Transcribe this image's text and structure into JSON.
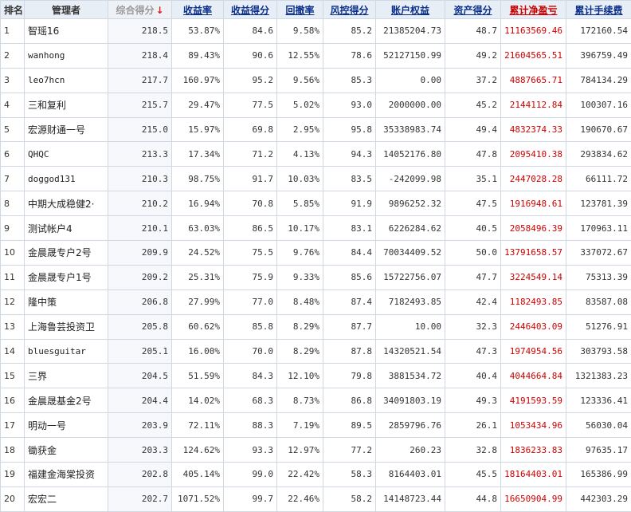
{
  "headers": {
    "rank": "排名",
    "manager": "管理者",
    "composite": "综合得分",
    "composite_arrow": "↓",
    "return_rate": "收益率",
    "return_score": "收益得分",
    "drawdown": "回撤率",
    "risk_score": "风控得分",
    "equity": "账户权益",
    "asset_score": "资产得分",
    "cum_pnl": "累计净盈亏",
    "cum_fee": "累计手续费"
  },
  "colors": {
    "header_link": "#0a2f8a",
    "pnl_red": "#d00000",
    "sort_arrow": "#e02020",
    "header_bg": "#e8eef5",
    "border": "#cfd8e3"
  },
  "rows": [
    {
      "rank": "1",
      "manager": "智瑶16",
      "composite": "218.5",
      "return_rate": "53.87%",
      "return_score": "84.6",
      "drawdown": "9.58%",
      "risk_score": "85.2",
      "equity": "21385204.73",
      "asset_score": "48.7",
      "cum_pnl": "11163569.46",
      "cum_fee": "172160.54"
    },
    {
      "rank": "2",
      "manager": "wanhong",
      "composite": "218.4",
      "return_rate": "89.43%",
      "return_score": "90.6",
      "drawdown": "12.55%",
      "risk_score": "78.6",
      "equity": "52127150.99",
      "asset_score": "49.2",
      "cum_pnl": "21604565.51",
      "cum_fee": "396759.49"
    },
    {
      "rank": "3",
      "manager": "leo7hcn",
      "composite": "217.7",
      "return_rate": "160.97%",
      "return_score": "95.2",
      "drawdown": "9.56%",
      "risk_score": "85.3",
      "equity": "0.00",
      "asset_score": "37.2",
      "cum_pnl": "4887665.71",
      "cum_fee": "784134.29"
    },
    {
      "rank": "4",
      "manager": "三和复利",
      "composite": "215.7",
      "return_rate": "29.47%",
      "return_score": "77.5",
      "drawdown": "5.02%",
      "risk_score": "93.0",
      "equity": "2000000.00",
      "asset_score": "45.2",
      "cum_pnl": "2144112.84",
      "cum_fee": "100307.16"
    },
    {
      "rank": "5",
      "manager": "宏源财通一号",
      "composite": "215.0",
      "return_rate": "15.97%",
      "return_score": "69.8",
      "drawdown": "2.95%",
      "risk_score": "95.8",
      "equity": "35338983.74",
      "asset_score": "49.4",
      "cum_pnl": "4832374.33",
      "cum_fee": "190670.67"
    },
    {
      "rank": "6",
      "manager": "QHQC",
      "composite": "213.3",
      "return_rate": "17.34%",
      "return_score": "71.2",
      "drawdown": "4.13%",
      "risk_score": "94.3",
      "equity": "14052176.80",
      "asset_score": "47.8",
      "cum_pnl": "2095410.38",
      "cum_fee": "293834.62"
    },
    {
      "rank": "7",
      "manager": "doggod131",
      "composite": "210.3",
      "return_rate": "98.75%",
      "return_score": "91.7",
      "drawdown": "10.03%",
      "risk_score": "83.5",
      "equity": "-242099.98",
      "asset_score": "35.1",
      "cum_pnl": "2447028.28",
      "cum_fee": "66111.72"
    },
    {
      "rank": "8",
      "manager": "中期大成稳健2·",
      "composite": "210.2",
      "return_rate": "16.94%",
      "return_score": "70.8",
      "drawdown": "5.85%",
      "risk_score": "91.9",
      "equity": "9896252.32",
      "asset_score": "47.5",
      "cum_pnl": "1916948.61",
      "cum_fee": "123781.39"
    },
    {
      "rank": "9",
      "manager": "测试帐户4",
      "composite": "210.1",
      "return_rate": "63.03%",
      "return_score": "86.5",
      "drawdown": "10.17%",
      "risk_score": "83.1",
      "equity": "6226284.62",
      "asset_score": "40.5",
      "cum_pnl": "2058496.39",
      "cum_fee": "170963.11"
    },
    {
      "rank": "10",
      "manager": "金晨晟专户2号",
      "composite": "209.9",
      "return_rate": "24.52%",
      "return_score": "75.5",
      "drawdown": "9.76%",
      "risk_score": "84.4",
      "equity": "70034409.52",
      "asset_score": "50.0",
      "cum_pnl": "13791658.57",
      "cum_fee": "337072.67"
    },
    {
      "rank": "11",
      "manager": "金晨晟专户1号",
      "composite": "209.2",
      "return_rate": "25.31%",
      "return_score": "75.9",
      "drawdown": "9.33%",
      "risk_score": "85.6",
      "equity": "15722756.07",
      "asset_score": "47.7",
      "cum_pnl": "3224549.14",
      "cum_fee": "75313.39"
    },
    {
      "rank": "12",
      "manager": "隆中策",
      "composite": "206.8",
      "return_rate": "27.99%",
      "return_score": "77.0",
      "drawdown": "8.48%",
      "risk_score": "87.4",
      "equity": "7182493.85",
      "asset_score": "42.4",
      "cum_pnl": "1182493.85",
      "cum_fee": "83587.08"
    },
    {
      "rank": "13",
      "manager": "上海鲁芸投资卫",
      "composite": "205.8",
      "return_rate": "60.62%",
      "return_score": "85.8",
      "drawdown": "8.29%",
      "risk_score": "87.7",
      "equity": "10.00",
      "asset_score": "32.3",
      "cum_pnl": "2446403.09",
      "cum_fee": "51276.91"
    },
    {
      "rank": "14",
      "manager": "bluesguitar",
      "composite": "205.1",
      "return_rate": "16.00%",
      "return_score": "70.0",
      "drawdown": "8.29%",
      "risk_score": "87.8",
      "equity": "14320521.54",
      "asset_score": "47.3",
      "cum_pnl": "1974954.56",
      "cum_fee": "303793.58"
    },
    {
      "rank": "15",
      "manager": "三界",
      "composite": "204.5",
      "return_rate": "51.59%",
      "return_score": "84.3",
      "drawdown": "12.10%",
      "risk_score": "79.8",
      "equity": "3881534.72",
      "asset_score": "40.4",
      "cum_pnl": "4044664.84",
      "cum_fee": "1321383.23"
    },
    {
      "rank": "16",
      "manager": "金晨晟基金2号",
      "composite": "204.4",
      "return_rate": "14.02%",
      "return_score": "68.3",
      "drawdown": "8.73%",
      "risk_score": "86.8",
      "equity": "34091803.19",
      "asset_score": "49.3",
      "cum_pnl": "4191593.59",
      "cum_fee": "123336.41"
    },
    {
      "rank": "17",
      "manager": "明动一号",
      "composite": "203.9",
      "return_rate": "72.11%",
      "return_score": "88.3",
      "drawdown": "7.19%",
      "risk_score": "89.5",
      "equity": "2859796.76",
      "asset_score": "26.1",
      "cum_pnl": "1053434.96",
      "cum_fee": "56030.04"
    },
    {
      "rank": "18",
      "manager": "锄获金",
      "composite": "203.3",
      "return_rate": "124.62%",
      "return_score": "93.3",
      "drawdown": "12.97%",
      "risk_score": "77.2",
      "equity": "260.23",
      "asset_score": "32.8",
      "cum_pnl": "1836233.83",
      "cum_fee": "97635.17"
    },
    {
      "rank": "19",
      "manager": "福建金海棠投资",
      "composite": "202.8",
      "return_rate": "405.14%",
      "return_score": "99.0",
      "drawdown": "22.42%",
      "risk_score": "58.3",
      "equity": "8164403.01",
      "asset_score": "45.5",
      "cum_pnl": "18164403.01",
      "cum_fee": "165386.99"
    },
    {
      "rank": "20",
      "manager": "宏宏二",
      "composite": "202.7",
      "return_rate": "1071.52%",
      "return_score": "99.7",
      "drawdown": "22.46%",
      "risk_score": "58.2",
      "equity": "14148723.44",
      "asset_score": "44.8",
      "cum_pnl": "16650904.99",
      "cum_fee": "442303.29"
    }
  ]
}
